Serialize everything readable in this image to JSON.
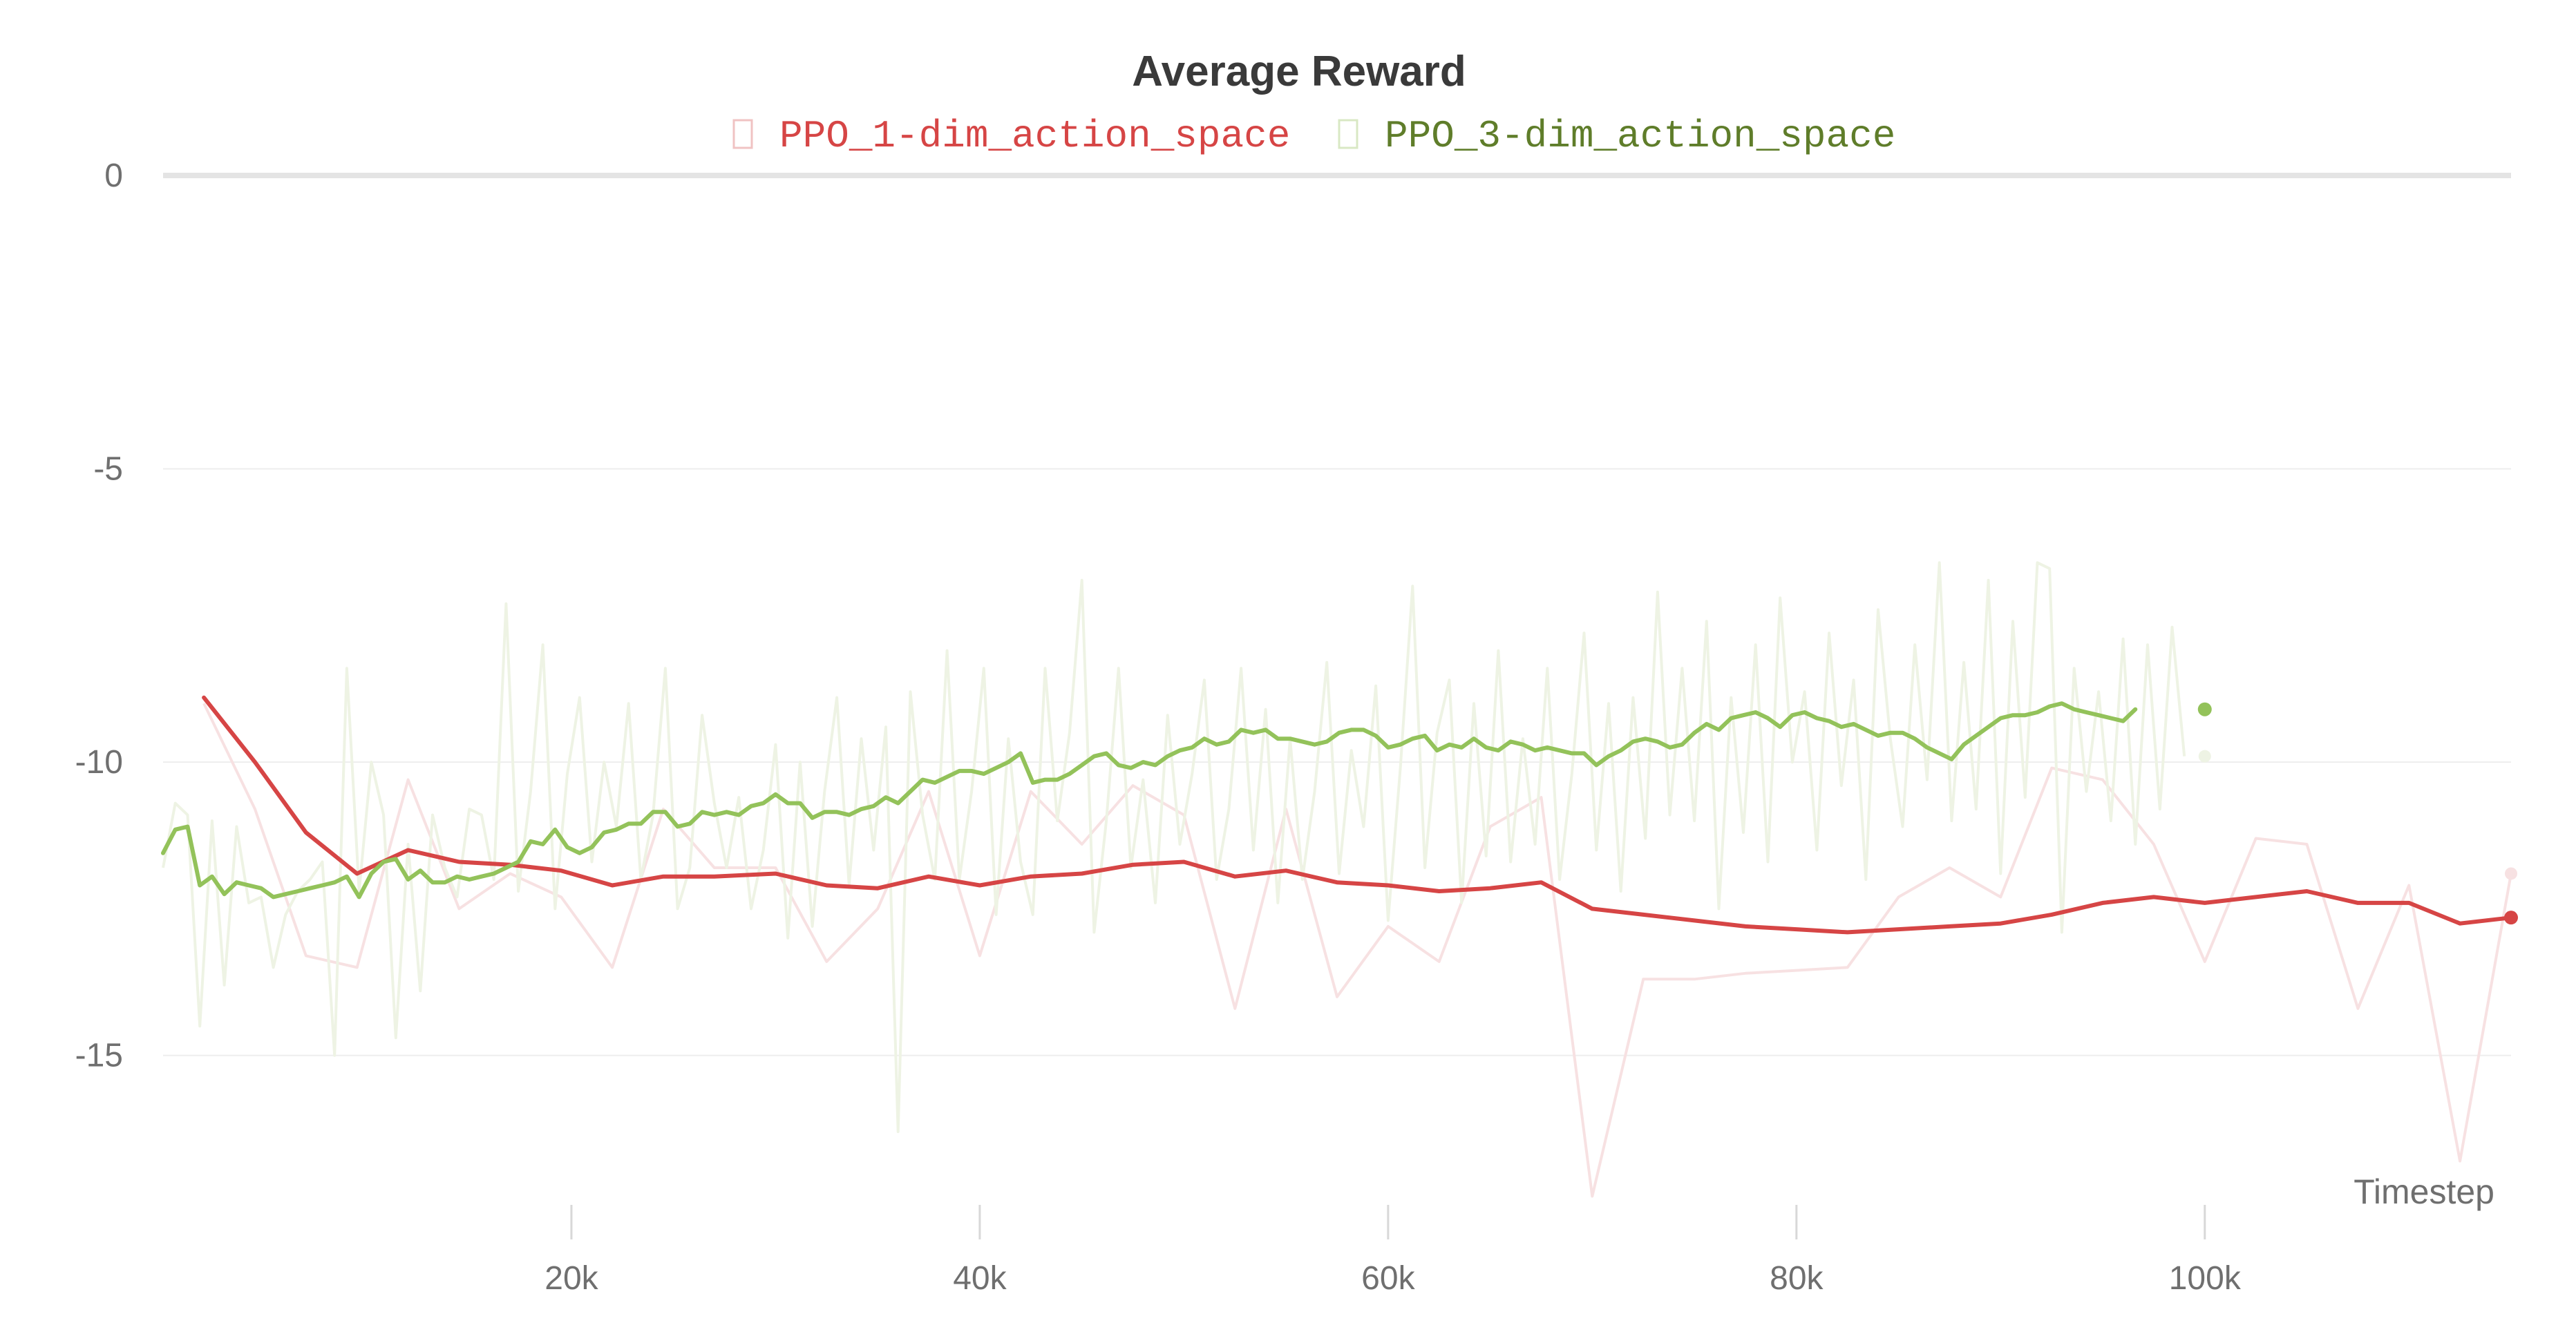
{
  "chart_data": {
    "type": "line",
    "title": "Average Reward",
    "xlabel": "Timestep",
    "ylabel": "",
    "xlim": [
      0,
      115000
    ],
    "ylim": [
      -17.5,
      0
    ],
    "x_ticks": [
      20000,
      40000,
      60000,
      80000,
      100000
    ],
    "x_tick_labels": [
      "20k",
      "40k",
      "60k",
      "80k",
      "100k"
    ],
    "y_ticks": [
      0,
      -5,
      -10,
      -15
    ],
    "y_tick_labels": [
      "0",
      "-5",
      "-10",
      "-15"
    ],
    "grid": true,
    "legend_position": "top-center",
    "series": [
      {
        "name": "PPO_1-dim_action_space",
        "color": "#d64545",
        "raw_color": "#f7e1e2",
        "smoothed": {
          "x": [
            2000,
            4500,
            7000,
            9500,
            12000,
            14500,
            17000,
            19500,
            22000,
            24500,
            27000,
            30000,
            32500,
            35000,
            37500,
            40000,
            42500,
            45000,
            47500,
            50000,
            52500,
            55000,
            57500,
            60000,
            62500,
            65000,
            67500,
            70000,
            72500,
            75000,
            77500,
            80000,
            82500,
            85000,
            87500,
            90000,
            92500,
            95000,
            97500,
            100000,
            102500,
            105000,
            107500,
            110000,
            112500,
            115000
          ],
          "y": [
            -8.9,
            -10.0,
            -11.2,
            -11.9,
            -11.5,
            -11.7,
            -11.75,
            -11.85,
            -12.1,
            -11.95,
            -11.95,
            -11.9,
            -12.1,
            -12.15,
            -11.95,
            -12.1,
            -11.95,
            -11.9,
            -11.75,
            -11.7,
            -11.95,
            -11.85,
            -12.05,
            -12.1,
            -12.2,
            -12.15,
            -12.05,
            -12.5,
            -12.6,
            -12.7,
            -12.8,
            -12.85,
            -12.9,
            -12.85,
            -12.8,
            -12.75,
            -12.6,
            -12.4,
            -12.3,
            -12.4,
            -12.3,
            -12.2,
            -12.4,
            -12.4,
            -12.75,
            -12.65
          ]
        },
        "raw": {
          "x": [
            2000,
            4500,
            7000,
            9500,
            12000,
            14500,
            17000,
            19500,
            22000,
            24500,
            27000,
            30000,
            32500,
            35000,
            37500,
            40000,
            42500,
            45000,
            47500,
            50000,
            52500,
            55000,
            57500,
            60000,
            62500,
            65000,
            67500,
            70000,
            72500,
            75000,
            77500,
            80000,
            82500,
            85000,
            87500,
            90000,
            92500,
            95000,
            97500,
            100000,
            102500,
            105000,
            107500,
            110000,
            112500,
            115000
          ],
          "y": [
            -9.0,
            -10.8,
            -13.3,
            -13.5,
            -10.3,
            -12.5,
            -11.9,
            -12.3,
            -13.5,
            -10.8,
            -11.8,
            -11.8,
            -13.4,
            -12.5,
            -10.5,
            -13.3,
            -10.5,
            -11.4,
            -10.4,
            -10.9,
            -14.2,
            -10.8,
            -14.0,
            -12.8,
            -13.4,
            -11.1,
            -10.6,
            -17.4,
            -13.7,
            -13.7,
            -13.6,
            -13.55,
            -13.5,
            -12.3,
            -11.8,
            -12.3,
            -10.1,
            -10.3,
            -11.4,
            -13.4,
            -11.3,
            -11.4,
            -14.2,
            -12.1,
            -16.8,
            -11.9
          ]
        }
      },
      {
        "name": "PPO_3-dim_action_space",
        "color": "#93c25a",
        "raw_color": "#eef3e4",
        "smoothed": {
          "x": [
            0,
            600,
            1200,
            1800,
            2400,
            3000,
            3600,
            4200,
            4800,
            5400,
            6000,
            6600,
            7200,
            7800,
            8400,
            9000,
            9600,
            10200,
            10800,
            11400,
            12000,
            12600,
            13200,
            13800,
            14400,
            15000,
            15600,
            16200,
            16800,
            17400,
            18000,
            18600,
            19200,
            19800,
            20400,
            21000,
            21600,
            22200,
            22800,
            23400,
            24000,
            24600,
            25200,
            25800,
            26400,
            27000,
            27600,
            28200,
            28800,
            29400,
            30000,
            30600,
            31200,
            31800,
            32400,
            33000,
            33600,
            34200,
            34800,
            35400,
            36000,
            36600,
            37200,
            37800,
            38400,
            39000,
            39600,
            40200,
            40800,
            41400,
            42000,
            42600,
            43200,
            43800,
            44400,
            45000,
            45600,
            46200,
            46800,
            47400,
            48000,
            48600,
            49200,
            49800,
            50400,
            51000,
            51600,
            52200,
            52800,
            53400,
            54000,
            54600,
            55200,
            55800,
            56400,
            57000,
            57600,
            58200,
            58800,
            59400,
            60000,
            60600,
            61200,
            61800,
            62400,
            63000,
            63600,
            64200,
            64800,
            65400,
            66000,
            66600,
            67200,
            67800,
            68400,
            69000,
            69600,
            70200,
            70800,
            71400,
            72000,
            72600,
            73200,
            73800,
            74400,
            75000,
            75600,
            76200,
            76800,
            77400,
            78000,
            78600,
            79200,
            79800,
            80400,
            81000,
            81600,
            82200,
            82800,
            83400,
            84000,
            84600,
            85200,
            85800,
            86400,
            87000,
            87600,
            88200,
            88800,
            89400,
            90000,
            90600,
            91200,
            91800,
            92400,
            93000,
            93600,
            94200,
            94800,
            95400,
            96000,
            96600,
            97200,
            97800,
            98400,
            99000,
            99600,
            100000
          ],
          "y": [
            -11.55,
            -11.15,
            -11.1,
            -12.1,
            -11.95,
            -12.25,
            -12.05,
            -12.1,
            -12.15,
            -12.3,
            -12.25,
            -12.2,
            -12.15,
            -12.1,
            -12.05,
            -11.95,
            -12.3,
            -11.9,
            -11.7,
            -11.65,
            -12.0,
            -11.85,
            -12.05,
            -12.05,
            -11.95,
            -12.0,
            -11.95,
            -11.9,
            -11.8,
            -11.7,
            -11.35,
            -11.4,
            -11.15,
            -11.45,
            -11.55,
            -11.45,
            -11.2,
            -11.15,
            -11.05,
            -11.05,
            -10.85,
            -10.85,
            -11.1,
            -11.05,
            -10.85,
            -10.9,
            -10.85,
            -10.9,
            -10.75,
            -10.7,
            -10.55,
            -10.7,
            -10.7,
            -10.95,
            -10.85,
            -10.85,
            -10.9,
            -10.8,
            -10.75,
            -10.6,
            -10.7,
            -10.5,
            -10.3,
            -10.35,
            -10.25,
            -10.15,
            -10.15,
            -10.2,
            -10.1,
            -10.0,
            -9.85,
            -10.35,
            -10.3,
            -10.3,
            -10.2,
            -10.05,
            -9.9,
            -9.85,
            -10.05,
            -10.1,
            -10.0,
            -10.05,
            -9.9,
            -9.8,
            -9.75,
            -9.6,
            -9.7,
            -9.65,
            -9.45,
            -9.5,
            -9.45,
            -9.6,
            -9.6,
            -9.65,
            -9.7,
            -9.65,
            -9.5,
            -9.45,
            -9.45,
            -9.55,
            -9.75,
            -9.7,
            -9.6,
            -9.55,
            -9.8,
            -9.7,
            -9.75,
            -9.6,
            -9.75,
            -9.8,
            -9.65,
            -9.7,
            -9.8,
            -9.75,
            -9.8,
            -9.85,
            -9.85,
            -10.05,
            -9.9,
            -9.8,
            -9.65,
            -9.6,
            -9.65,
            -9.75,
            -9.7,
            -9.5,
            -9.35,
            -9.45,
            -9.25,
            -9.2,
            -9.15,
            -9.25,
            -9.4,
            -9.2,
            -9.15,
            -9.25,
            -9.3,
            -9.4,
            -9.35,
            -9.45,
            -9.55,
            -9.5,
            -9.5,
            -9.6,
            -9.75,
            -9.85,
            -9.95,
            -9.7,
            -9.55,
            -9.4,
            -9.25,
            -9.2,
            -9.2,
            -9.15,
            -9.05,
            -9.0,
            -9.1,
            -9.15,
            -9.2,
            -9.25,
            -9.3,
            -9.1
          ]
        },
        "raw": {
          "x": [
            0,
            600,
            1200,
            1800,
            2400,
            3000,
            3600,
            4200,
            4800,
            5400,
            6000,
            6600,
            7200,
            7800,
            8400,
            9000,
            9600,
            10200,
            10800,
            11400,
            12000,
            12600,
            13200,
            13800,
            14400,
            15000,
            15600,
            16200,
            16800,
            17400,
            18000,
            18600,
            19200,
            19800,
            20400,
            21000,
            21600,
            22200,
            22800,
            23400,
            24000,
            24600,
            25200,
            25800,
            26400,
            27000,
            27600,
            28200,
            28800,
            29400,
            30000,
            30600,
            31200,
            31800,
            32400,
            33000,
            33600,
            34200,
            34800,
            35400,
            36000,
            36600,
            37200,
            37800,
            38400,
            39000,
            39600,
            40200,
            40800,
            41400,
            42000,
            42600,
            43200,
            43800,
            44400,
            45000,
            45600,
            46200,
            46800,
            47400,
            48000,
            48600,
            49200,
            49800,
            50400,
            51000,
            51600,
            52200,
            52800,
            53400,
            54000,
            54600,
            55200,
            55800,
            56400,
            57000,
            57600,
            58200,
            58800,
            59400,
            60000,
            60600,
            61200,
            61800,
            62400,
            63000,
            63600,
            64200,
            64800,
            65400,
            66000,
            66600,
            67200,
            67800,
            68400,
            69000,
            69600,
            70200,
            70800,
            71400,
            72000,
            72600,
            73200,
            73800,
            74400,
            75000,
            75600,
            76200,
            76800,
            77400,
            78000,
            78600,
            79200,
            79800,
            80400,
            81000,
            81600,
            82200,
            82800,
            83400,
            84000,
            84600,
            85200,
            85800,
            86400,
            87000,
            87600,
            88200,
            88800,
            89400,
            90000,
            90600,
            91200,
            91800,
            92400,
            93000,
            93600,
            94200,
            94800,
            95400,
            96000,
            96600,
            97200,
            97800,
            98400,
            99000,
            99600,
            100000
          ],
          "y": [
            -11.8,
            -10.7,
            -10.9,
            -14.5,
            -11.0,
            -13.8,
            -11.1,
            -12.4,
            -12.3,
            -13.5,
            -12.6,
            -12.2,
            -12.0,
            -11.7,
            -15.0,
            -8.4,
            -12.2,
            -10.0,
            -10.9,
            -14.7,
            -11.4,
            -13.9,
            -10.9,
            -11.8,
            -12.3,
            -10.8,
            -10.9,
            -12.0,
            -7.3,
            -12.2,
            -10.5,
            -8.0,
            -12.5,
            -10.2,
            -8.9,
            -11.7,
            -10.0,
            -11.1,
            -9.0,
            -12.0,
            -10.9,
            -8.4,
            -12.5,
            -11.8,
            -9.2,
            -10.7,
            -11.8,
            -10.6,
            -12.5,
            -11.5,
            -9.7,
            -13.0,
            -10.0,
            -12.8,
            -10.5,
            -8.9,
            -12.1,
            -9.6,
            -11.5,
            -9.4,
            -16.3,
            -8.8,
            -10.9,
            -12.0,
            -8.1,
            -12.0,
            -10.5,
            -8.4,
            -12.6,
            -9.6,
            -11.7,
            -12.6,
            -8.4,
            -11.0,
            -9.5,
            -6.9,
            -12.9,
            -11.0,
            -8.4,
            -11.8,
            -10.3,
            -12.4,
            -9.2,
            -11.4,
            -10.2,
            -8.6,
            -12.0,
            -10.8,
            -8.4,
            -11.5,
            -9.1,
            -12.4,
            -9.6,
            -12.0,
            -10.5,
            -8.3,
            -11.9,
            -9.8,
            -11.1,
            -8.7,
            -12.7,
            -10.1,
            -7.0,
            -11.8,
            -9.5,
            -8.6,
            -12.4,
            -9.0,
            -11.6,
            -8.1,
            -11.7,
            -9.6,
            -11.4,
            -8.4,
            -12.0,
            -10.2,
            -7.8,
            -11.5,
            -9.0,
            -12.2,
            -8.9,
            -11.3,
            -7.1,
            -10.9,
            -8.4,
            -11.0,
            -7.6,
            -12.5,
            -8.9,
            -11.2,
            -8.0,
            -11.7,
            -7.2,
            -10.0,
            -8.8,
            -11.5,
            -7.8,
            -10.4,
            -8.6,
            -12.0,
            -7.4,
            -9.6,
            -11.1,
            -8.0,
            -10.3,
            -6.6,
            -11.0,
            -8.3,
            -10.8,
            -6.9,
            -11.9,
            -7.6,
            -10.6,
            -6.6,
            -6.7,
            -12.9,
            -8.4,
            -10.5,
            -8.8,
            -11.0,
            -7.9,
            -11.4,
            -8.0,
            -10.8,
            -7.7,
            -9.9
          ]
        }
      }
    ]
  }
}
